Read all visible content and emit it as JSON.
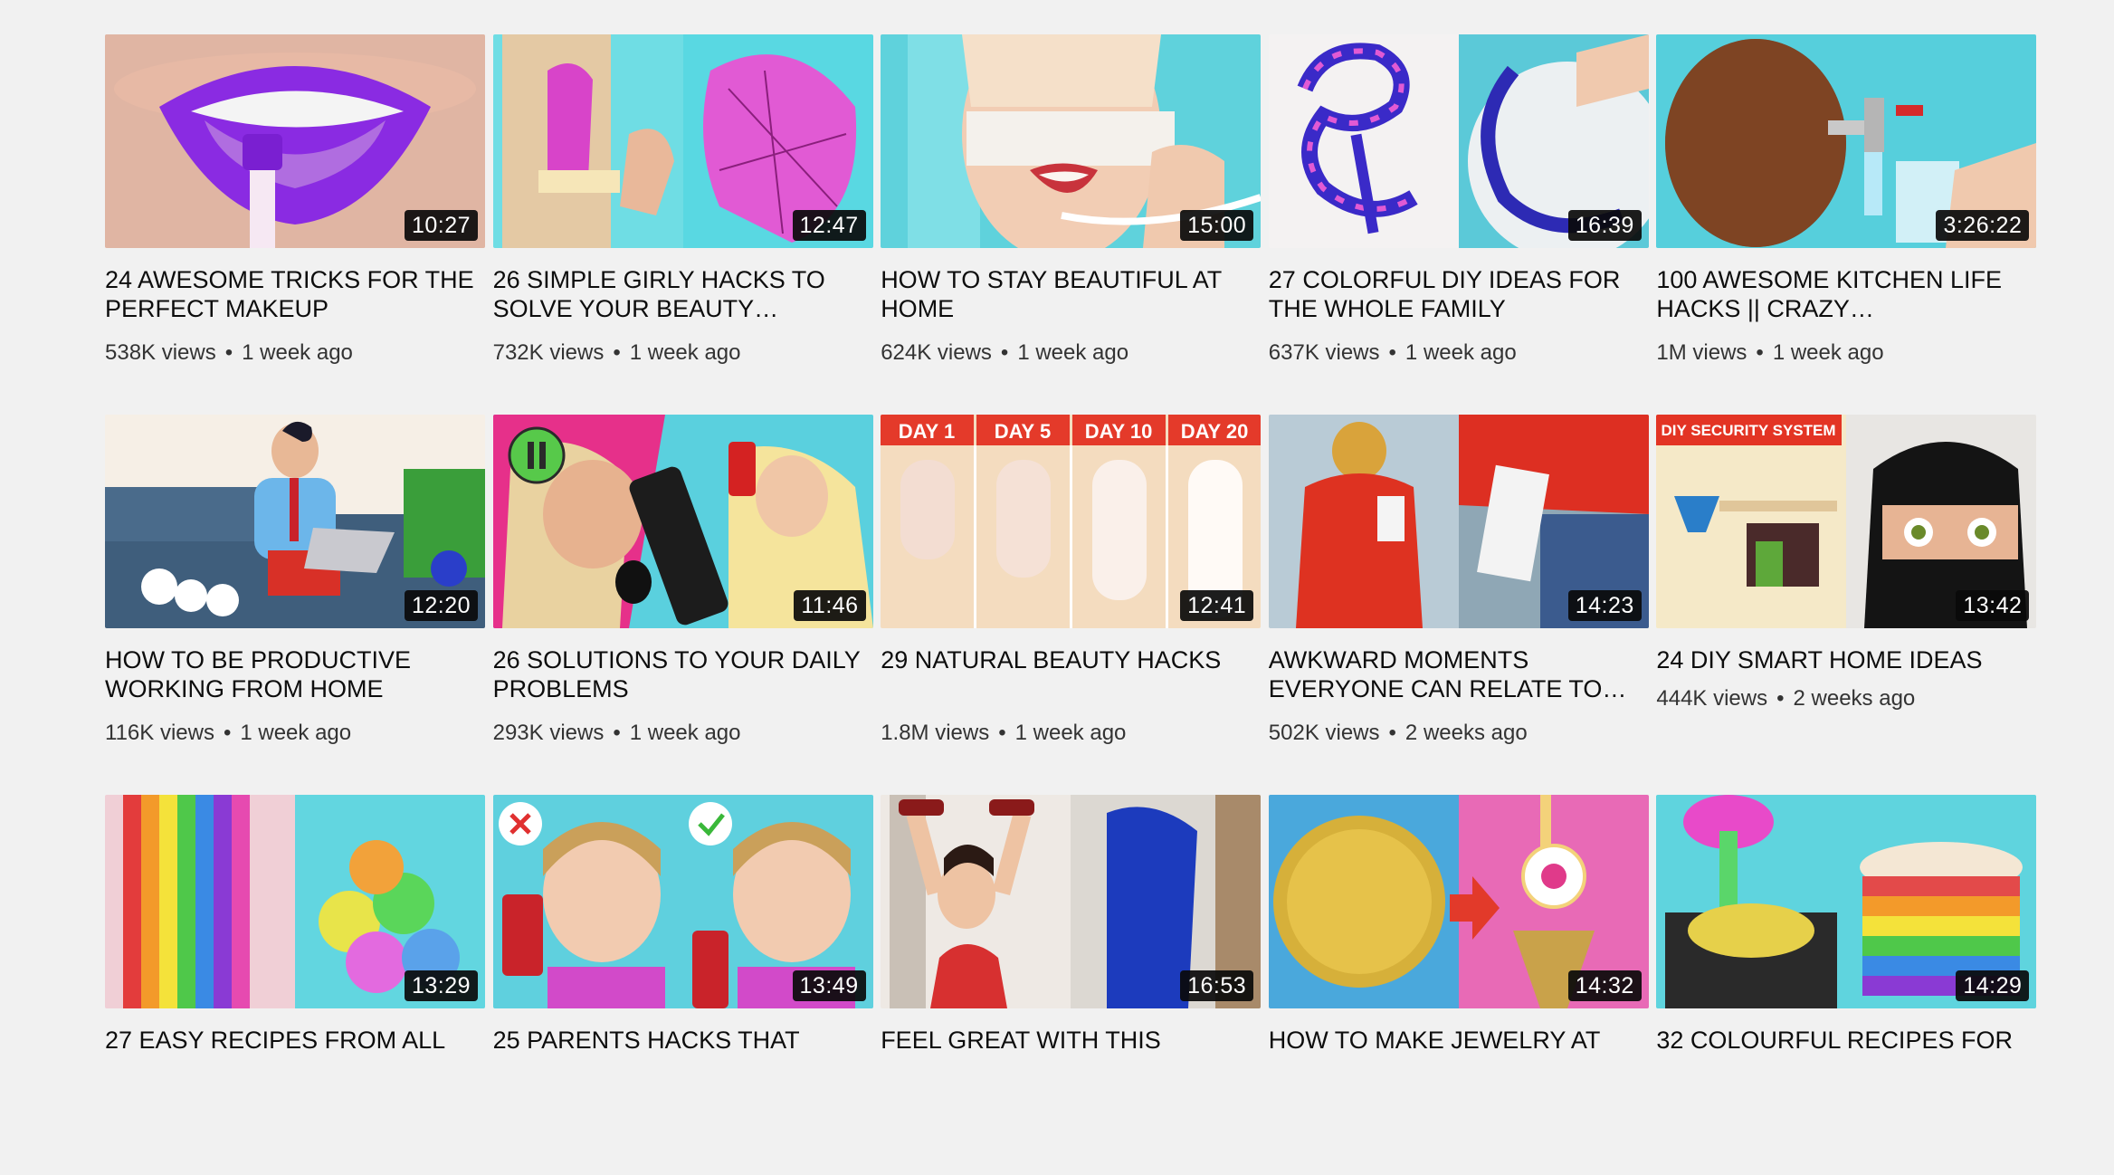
{
  "videos": [
    [
      {
        "title": "24 AWESOME TRICKS FOR THE PERFECT MAKEUP",
        "duration": "10:27",
        "views": "538K views",
        "age": "1 week ago",
        "thumb_icon": "purple-lips-thumbnail"
      },
      {
        "title": "26 SIMPLE GIRLY HACKS TO SOLVE YOUR BEAUTY…",
        "duration": "12:47",
        "views": "732K views",
        "age": "1 week ago",
        "thumb_icon": "wax-strip-thumbnail"
      },
      {
        "title": "HOW TO STAY BEAUTIFUL AT HOME",
        "duration": "15:00",
        "views": "624K views",
        "age": "1 week ago",
        "thumb_icon": "face-mask-thumbnail"
      },
      {
        "title": "27 COLORFUL DIY IDEAS FOR THE WHOLE FAMILY",
        "duration": "16:39",
        "views": "637K views",
        "age": "1 week ago",
        "thumb_icon": "colorful-spiral-thumbnail"
      },
      {
        "title": "100 AWESOME KITCHEN LIFE HACKS || CRAZY…",
        "duration": "3:26:22",
        "views": "1M views",
        "age": "1 week ago",
        "thumb_icon": "coconut-faucet-thumbnail"
      }
    ],
    [
      {
        "title": "HOW TO BE PRODUCTIVE WORKING FROM HOME",
        "duration": "12:20",
        "views": "116K views",
        "age": "1 week ago",
        "thumb_icon": "man-laptop-couch-thumbnail"
      },
      {
        "title": "26 SOLUTIONS TO YOUR DAILY PROBLEMS",
        "duration": "11:46",
        "views": "293K views",
        "age": "1 week ago",
        "thumb_icon": "remote-phone-thumbnail"
      },
      {
        "title": "29 NATURAL BEAUTY HACKS",
        "duration": "12:41",
        "views": "1.8M views",
        "age": "1 week ago",
        "thumb_icon": "nails-days-thumbnail"
      },
      {
        "title": "AWKWARD MOMENTS EVERYONE CAN RELATE TO…",
        "duration": "14:23",
        "views": "502K views",
        "age": "2 weeks ago",
        "thumb_icon": "red-jacket-thumbnail"
      },
      {
        "title": "24 DIY SMART HOME IDEAS",
        "duration": "13:42",
        "views": "444K views",
        "age": "2 weeks ago",
        "thumb_icon": "security-system-thumbnail"
      }
    ],
    [
      {
        "title": "27 EASY RECIPES FROM ALL",
        "duration": "13:29",
        "thumb_icon": "rainbow-food-thumbnail"
      },
      {
        "title": "25 PARENTS HACKS THAT",
        "duration": "13:49",
        "thumb_icon": "girl-medicine-thumbnail"
      },
      {
        "title": "FEEL GREAT WITH THIS",
        "duration": "16:53",
        "thumb_icon": "workout-bottles-thumbnail"
      },
      {
        "title": "HOW TO MAKE JEWELRY AT",
        "duration": "14:32",
        "thumb_icon": "coin-earring-thumbnail"
      },
      {
        "title": "32 COLOURFUL RECIPES FOR",
        "duration": "14:29",
        "thumb_icon": "rainbow-pancakes-thumbnail"
      }
    ]
  ],
  "thumb_text": {
    "nails_days": [
      "DAY 1",
      "DAY 5",
      "DAY 10",
      "DAY 20"
    ],
    "security_banner": "DIY SECURITY SYSTEM"
  }
}
